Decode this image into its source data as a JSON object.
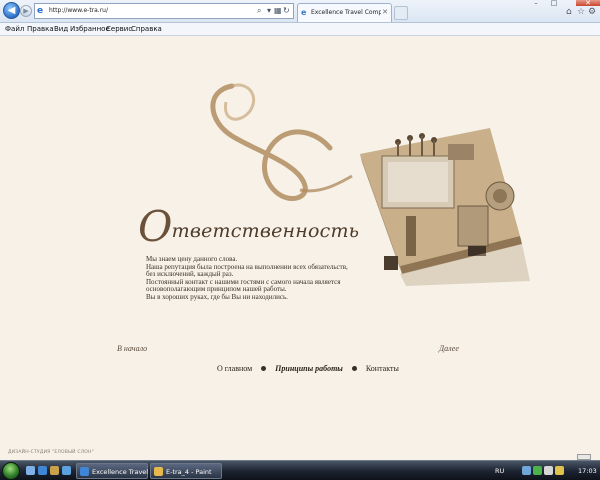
{
  "browser": {
    "address": "http://www.e-tra.ru/",
    "tab_title": "Excellence Travel Company..."
  },
  "menu": [
    "Файл",
    "Правка",
    "Вид",
    "Избранное",
    "Сервис",
    "Справка"
  ],
  "page": {
    "heading_initial": "О",
    "heading_rest": "тветственность",
    "paragraph_lines": [
      "Мы знаем цену данного слова.",
      "Наша репутация была построена на выполнении всех обязательств,",
      "без исключений, каждый раз.",
      "Постоянный контакт с нашими гостями с самого начала является",
      "основополагающим принципом нашей работы.",
      "Вы в хороших руках, где бы Вы ни находились."
    ],
    "pager": {
      "prev": "В начало",
      "next": "Далее"
    },
    "nav": {
      "about": "О главном",
      "principles": "Принципы работы",
      "contacts": "Контакты"
    },
    "credit": "ДИЗАЙН-СТУДИЯ \"ЕЛОВЫЙ СЛОН\""
  },
  "taskbar": {
    "tasks": [
      "Excellence Travel Co...",
      "E-tra_4 - Paint"
    ],
    "lang": "RU",
    "clock": "17:03"
  },
  "colors": {
    "page_bg": "#f7f1e8",
    "heading": "#4e3b2a",
    "ribbon": "#a9875d"
  }
}
